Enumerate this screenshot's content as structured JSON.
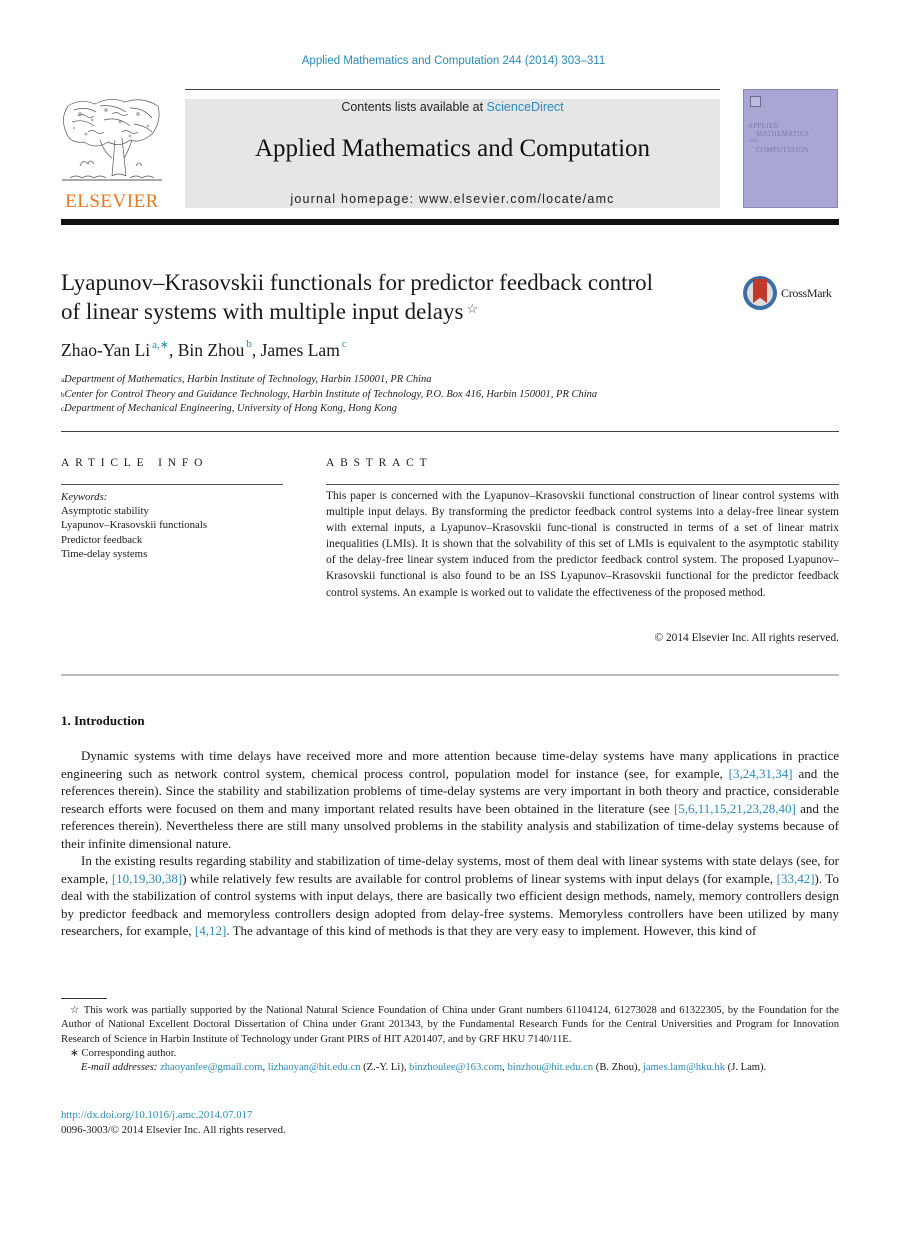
{
  "journal_ref": "Applied Mathematics and Computation 244 (2014) 303–311",
  "masthead": {
    "contents_prefix": "Contents lists available at ",
    "sciencedirect": "ScienceDirect",
    "journal_title": "Applied Mathematics and Computation",
    "homepage": "journal homepage: www.elsevier.com/locate/amc"
  },
  "publisher_logo": {
    "word": "ELSEVIER",
    "color": "#e87722"
  },
  "cover": {
    "line1": "APPLIED",
    "line2": "MATHEMATICS",
    "line3": "AND",
    "line4": "COMPUTATION",
    "color": "#a9a6d4"
  },
  "crossmark": {
    "label": "CrossMark"
  },
  "article": {
    "title_line1": "Lyapunov–Krasovskii functionals for predictor feedback control",
    "title_line2": "of linear systems with multiple input delays",
    "title_note_mark": "☆",
    "authors": [
      {
        "name": "Zhao-Yan Li",
        "sup": "a,∗",
        "sep": ", "
      },
      {
        "name": "Bin Zhou",
        "sup": "b",
        "sep": ", "
      },
      {
        "name": "James Lam",
        "sup": "c",
        "sep": ""
      }
    ],
    "affiliations": [
      {
        "mark": "a",
        "text": "Department of Mathematics, Harbin Institute of Technology, Harbin 150001, PR China"
      },
      {
        "mark": "b",
        "text": "Center for Control Theory and Guidance Technology, Harbin Institute of Technology, P.O. Box 416, Harbin 150001, PR China"
      },
      {
        "mark": "c",
        "text": "Department of Mechanical Engineering, University of Hong Kong, Hong Kong"
      }
    ]
  },
  "article_info": {
    "heading": "ARTICLE INFO",
    "keywords_label": "Keywords:",
    "keywords": [
      "Asymptotic stability",
      "Lyapunov–Krasovskii functionals",
      "Predictor feedback",
      "Time-delay systems"
    ]
  },
  "abstract": {
    "heading": "ABSTRACT",
    "text": "This paper is concerned with the Lyapunov–Krasovskii functional construction of linear control systems with multiple input delays. By transforming the predictor feedback control systems into a delay-free linear system with external inputs, a Lyapunov–Krasovskii func-tional is constructed in terms of a set of linear matrix inequalities (LMIs). It is shown that the solvability of this set of LMIs is equivalent to the asymptotic stability of the delay-free linear system induced from the predictor feedback control system. The proposed Lyapunov–Krasovskii functional is also found to be an ISS Lyapunov–Krasovskii functional for the predictor feedback control systems. An example is worked out to validate the effectiveness of the proposed method.",
    "copyright": "© 2014 Elsevier Inc. All rights reserved."
  },
  "introduction": {
    "heading": "1. Introduction",
    "p1": {
      "a": "Dynamic systems with time delays have received more and more attention because time-delay systems have many applications in practice engineering such as network control system, chemical process control, population model for instance (see, for example, ",
      "ref1": "[3,24,31,34]",
      "b": " and the references therein). Since the stability and stabilization problems of time-delay systems are very important in both theory and practice, considerable research efforts were focused on them and many important related results have been obtained in the literature (see ",
      "ref2": "[5,6,11,15,21,23,28,40]",
      "c": " and the references therein). Nevertheless there are still many unsolved problems in the stability analysis and stabilization of time-delay systems because of their infinite dimensional nature."
    },
    "p2": {
      "a": "In the existing results regarding stability and stabilization of time-delay systems, most of them deal with linear systems with state delays (see, for example, ",
      "ref1": "[10,19,30,38]",
      "b": ") while relatively few results are available for control problems of linear systems with input delays (for example, ",
      "ref2": "[33,42]",
      "c": "). To deal with the stabilization of control systems with input delays, there are basically two efficient design methods, namely, memory controllers design by predictor feedback and memoryless controllers design adopted from delay-free systems. Memoryless controllers have been utilized by many researchers, for example, ",
      "ref3": "[4,12]",
      "d": ". The advantage of this kind of methods is that they are very easy to implement. However, this kind of"
    }
  },
  "footnotes": {
    "funding_mark": "☆",
    "funding": "This work was partially supported by the National Natural Science Foundation of China under Grant numbers 61104124, 61273028 and 61322305, by the Foundation for the Author of National Excellent Doctoral Dissertation of China under Grant 201343, by the Fundamental Research Funds for the Central Universities and Program for Innovation Research of Science in Harbin Institute of Technology under Grant PIRS of HIT A201407, and by GRF HKU 7140/11E.",
    "corresponding_mark": "∗",
    "corresponding": "Corresponding author.",
    "email_label": "E-mail addresses:",
    "emails": [
      {
        "addr": "zhaoyanlee@gmail.com",
        "after": ", "
      },
      {
        "addr": "lizhaoyan@hit.edu.cn",
        "after": " (Z.-Y. Li), "
      },
      {
        "addr": "binzhoulee@163.com",
        "after": ", "
      },
      {
        "addr": "binzhou@hit.edu.cn",
        "after": " (B. Zhou), "
      },
      {
        "addr": "james.lam@hku.hk",
        "after": " (J. Lam)."
      }
    ]
  },
  "doi": {
    "link": "http://dx.doi.org/10.1016/j.amc.2014.07.017",
    "issn_line": "0096-3003/© 2014 Elsevier Inc. All rights reserved."
  },
  "colors": {
    "link": "#2a8ab8",
    "masthead_bg": "#e6e6e6"
  }
}
